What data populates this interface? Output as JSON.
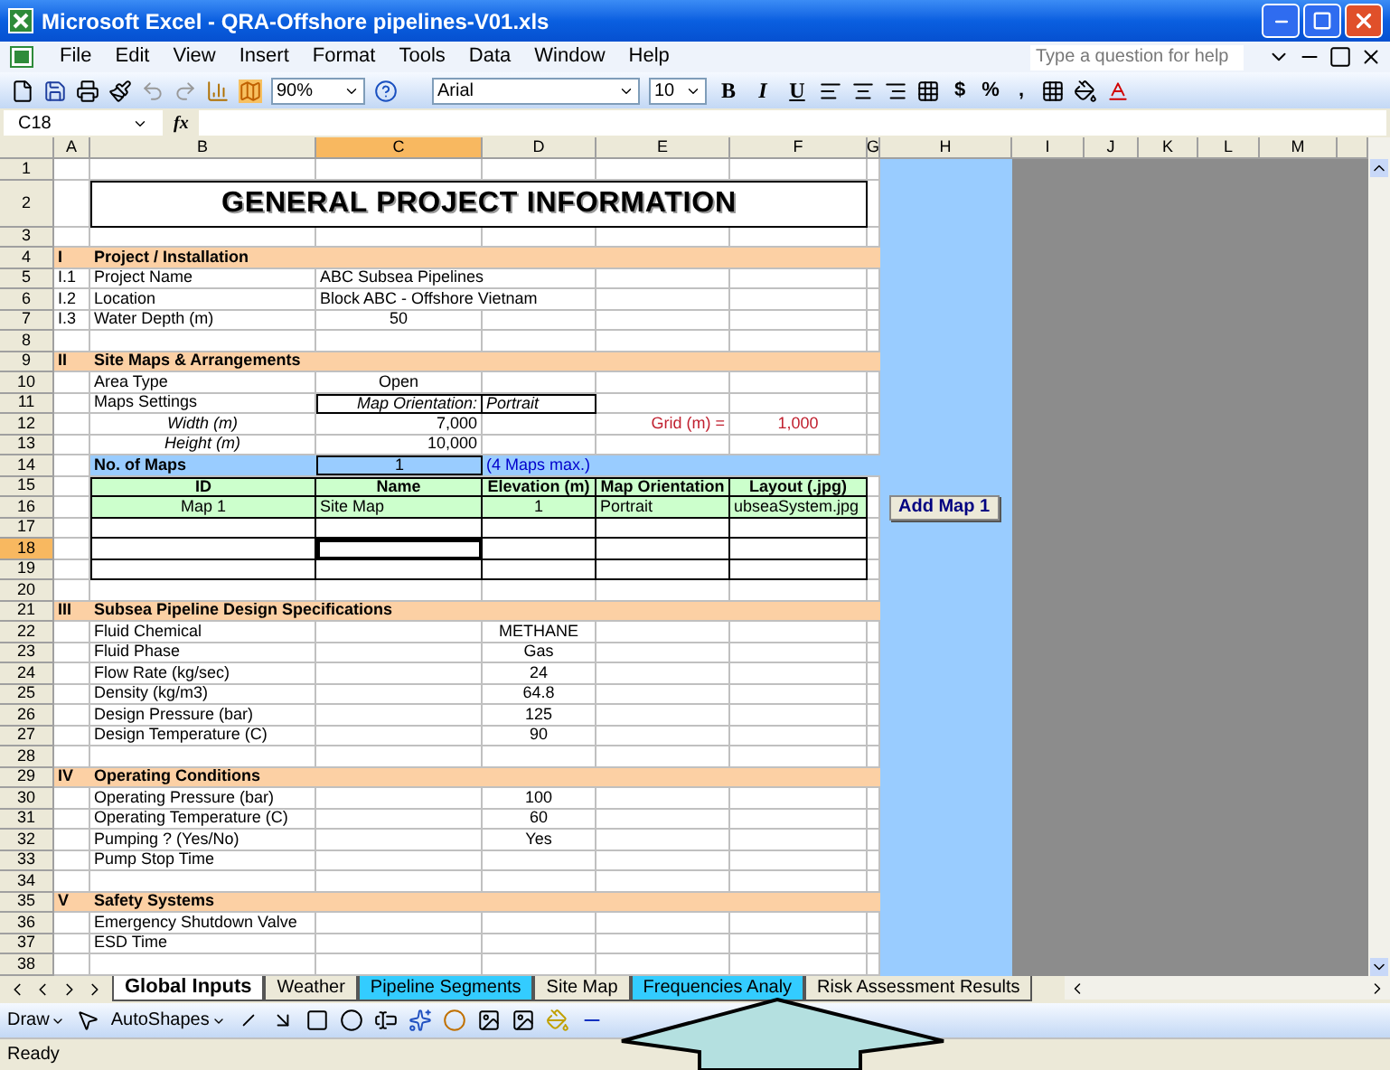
{
  "window": {
    "title": "Microsoft Excel - QRA-Offshore pipelines-V01.xls"
  },
  "menu": [
    "File",
    "Edit",
    "View",
    "Insert",
    "Format",
    "Tools",
    "Data",
    "Window",
    "Help"
  ],
  "help_box": {
    "placeholder": "Type a question for help"
  },
  "toolbar": {
    "zoom": "90%",
    "font": "Arial",
    "size": "10",
    "style_buttons": [
      "B",
      "I",
      "U"
    ],
    "number_buttons": [
      "$",
      "%",
      ","
    ]
  },
  "formula_bar": {
    "name_box": "C18",
    "function_label": "fx"
  },
  "columns": [
    {
      "label": "A",
      "selected": false
    },
    {
      "label": "B",
      "selected": false
    },
    {
      "label": "C",
      "selected": true
    },
    {
      "label": "D",
      "selected": false
    },
    {
      "label": "E",
      "selected": false
    },
    {
      "label": "F",
      "selected": false
    },
    {
      "label": "G",
      "selected": false
    },
    {
      "label": "H",
      "selected": false
    },
    {
      "label": "I",
      "selected": false
    },
    {
      "label": "J",
      "selected": false
    },
    {
      "label": "K",
      "selected": false
    },
    {
      "label": "L",
      "selected": false
    },
    {
      "label": "M",
      "selected": false
    }
  ],
  "rows": [
    {
      "n": "1",
      "kind": "blank",
      "selected": false,
      "cells": {}
    },
    {
      "n": "2",
      "kind": "title",
      "selected": false,
      "cells": {
        "B": "GENERAL PROJECT INFORMATION"
      }
    },
    {
      "n": "3",
      "kind": "blank",
      "selected": false,
      "cells": {}
    },
    {
      "n": "4",
      "kind": "section",
      "selected": false,
      "cells": {
        "A": "I",
        "B": "Project / Installation"
      }
    },
    {
      "n": "5",
      "kind": "info",
      "selected": false,
      "cells": {
        "A": "I.1",
        "B": "Project Name",
        "C": "ABC Subsea Pipelines"
      }
    },
    {
      "n": "6",
      "kind": "info",
      "selected": false,
      "cells": {
        "A": "I.2",
        "B": "Location",
        "C": "Block ABC - Offshore Vietnam"
      }
    },
    {
      "n": "7",
      "kind": "field",
      "selected": false,
      "cells": {
        "A": "I.3",
        "B": "Water Depth (m)",
        "C": "50"
      }
    },
    {
      "n": "8",
      "kind": "blank",
      "selected": false,
      "cells": {}
    },
    {
      "n": "9",
      "kind": "section",
      "selected": false,
      "cells": {
        "A": "II",
        "B": "Site Maps & Arrangements"
      }
    },
    {
      "n": "10",
      "kind": "field",
      "selected": false,
      "cells": {
        "B": "Area Type",
        "C": "Open"
      }
    },
    {
      "n": "11",
      "kind": "setting",
      "selected": false,
      "cells": {
        "B": "Maps Settings",
        "C": "Map Orientation:",
        "D": "Portrait"
      }
    },
    {
      "n": "12",
      "kind": "dimension",
      "selected": false,
      "cells": {
        "B": "Width (m)",
        "C": "7,000",
        "E": "Grid (m) =",
        "F": "1,000"
      }
    },
    {
      "n": "13",
      "kind": "dimension",
      "selected": false,
      "cells": {
        "B": "Height (m)",
        "C": "10,000"
      }
    },
    {
      "n": "14",
      "kind": "count",
      "selected": false,
      "cells": {
        "B": "No. of Maps",
        "C": "1",
        "D": "(4 Maps max.)"
      }
    },
    {
      "n": "15",
      "kind": "table-head",
      "selected": false,
      "cells": {
        "B": "ID",
        "C": "Name",
        "D": "Elevation (m)",
        "E": "Map Orientation",
        "F": "Layout (.jpg)"
      }
    },
    {
      "n": "16",
      "kind": "table-row",
      "selected": false,
      "cells": {
        "B": "Map 1",
        "C": "Site Map",
        "D": "1",
        "E": "Portrait",
        "F": "ubseaSystem.jpg"
      },
      "button": "Add Map 1"
    },
    {
      "n": "17",
      "kind": "table-row",
      "selected": false,
      "cells": {}
    },
    {
      "n": "18",
      "kind": "table-row",
      "selected": true,
      "cells": {}
    },
    {
      "n": "19",
      "kind": "table-row",
      "selected": false,
      "cells": {}
    },
    {
      "n": "20",
      "kind": "blank",
      "selected": false,
      "cells": {}
    },
    {
      "n": "21",
      "kind": "section",
      "selected": false,
      "cells": {
        "A": "III",
        "B": "Subsea Pipeline Design Specifications"
      }
    },
    {
      "n": "22",
      "kind": "spec",
      "selected": false,
      "cells": {
        "B": "Fluid Chemical",
        "D": "METHANE"
      }
    },
    {
      "n": "23",
      "kind": "spec",
      "selected": false,
      "cells": {
        "B": "Fluid Phase",
        "D": "Gas"
      }
    },
    {
      "n": "24",
      "kind": "spec",
      "selected": false,
      "cells": {
        "B": "Flow Rate (kg/sec)",
        "D": "24"
      }
    },
    {
      "n": "25",
      "kind": "spec",
      "selected": false,
      "cells": {
        "B": "Density (kg/m3)",
        "D": "64.8"
      }
    },
    {
      "n": "26",
      "kind": "spec",
      "selected": false,
      "cells": {
        "B": "Design Pressure (bar)",
        "D": "125"
      }
    },
    {
      "n": "27",
      "kind": "spec",
      "selected": false,
      "cells": {
        "B": "Design Temperature (C)",
        "D": "90"
      }
    },
    {
      "n": "28",
      "kind": "blank",
      "selected": false,
      "cells": {}
    },
    {
      "n": "29",
      "kind": "section",
      "selected": false,
      "cells": {
        "A": "IV",
        "B": "Operating Conditions"
      }
    },
    {
      "n": "30",
      "kind": "spec",
      "selected": false,
      "cells": {
        "B": "Operating Pressure (bar)",
        "D": "100"
      }
    },
    {
      "n": "31",
      "kind": "spec",
      "selected": false,
      "cells": {
        "B": "Operating Temperature (C)",
        "D": "60"
      }
    },
    {
      "n": "32",
      "kind": "spec",
      "selected": false,
      "cells": {
        "B": "Pumping ? (Yes/No)",
        "D": "Yes"
      }
    },
    {
      "n": "33",
      "kind": "spec",
      "selected": false,
      "cells": {
        "B": "Pump Stop Time"
      }
    },
    {
      "n": "34",
      "kind": "blank",
      "selected": false,
      "cells": {}
    },
    {
      "n": "35",
      "kind": "section",
      "selected": false,
      "cells": {
        "A": "V",
        "B": "Safety Systems"
      }
    },
    {
      "n": "36",
      "kind": "spec",
      "selected": false,
      "cells": {
        "B": "Emergency Shutdown Valve"
      }
    },
    {
      "n": "37",
      "kind": "spec",
      "selected": false,
      "cells": {
        "B": "ESD Time"
      }
    },
    {
      "n": "38",
      "kind": "blank",
      "selected": false,
      "cells": {}
    }
  ],
  "sheet_tabs": [
    {
      "label": "Global Inputs",
      "selected": true,
      "color": "#ffffff"
    },
    {
      "label": "Weather",
      "selected": false,
      "color": "#ece9d8"
    },
    {
      "label": "Pipeline Segments",
      "selected": false,
      "color": "#33ccff"
    },
    {
      "label": "Site Map",
      "selected": false,
      "color": "#ece9d8"
    },
    {
      "label": "Frequencies Analy",
      "selected": false,
      "color": "#33ccff"
    },
    {
      "label": "Risk Assessment Results",
      "selected": false,
      "color": "#ece9d8"
    }
  ],
  "drawing_toolbar": {
    "draw": "Draw",
    "autoshapes": "AutoShapes"
  },
  "status_bar": {
    "text": "Ready"
  }
}
